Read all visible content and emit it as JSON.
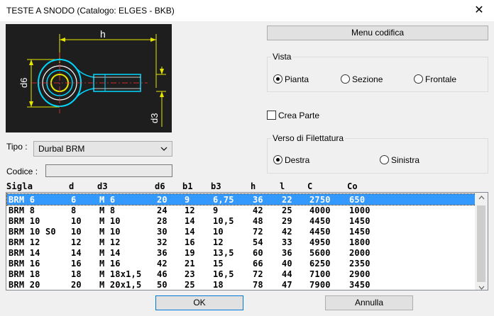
{
  "window": {
    "title": "TESTE A SNODO (Catalogo: ELGES - BKB)",
    "close_glyph": "✕"
  },
  "drawing": {
    "dim_h": "h",
    "dim_d6": "d6",
    "dim_d3": "d3"
  },
  "menu_button": "Menu codifica",
  "vista": {
    "label": "Vista",
    "options": [
      {
        "label": "Pianta",
        "selected": true
      },
      {
        "label": "Sezione",
        "selected": false
      },
      {
        "label": "Frontale",
        "selected": false
      }
    ]
  },
  "crea_parte": {
    "label": "Crea Parte",
    "checked": false
  },
  "verso": {
    "label": "Verso di Filettatura",
    "options": [
      {
        "label": "Destra",
        "selected": true
      },
      {
        "label": "Sinistra",
        "selected": false
      }
    ]
  },
  "tipo": {
    "label": "Tipo :",
    "value": "Durbal BRM"
  },
  "codice": {
    "label": "Codice :",
    "value": ""
  },
  "table": {
    "headers": [
      "Sigla",
      "d",
      "d3",
      "d6",
      "b1",
      "b3",
      "h",
      "l",
      "C",
      "Co"
    ],
    "rows": [
      [
        "BRM 6",
        "6",
        "M 6",
        "20",
        "9",
        "6,75",
        "36",
        "22",
        "2750",
        "650"
      ],
      [
        "BRM 8",
        "8",
        "M 8",
        "24",
        "12",
        "9",
        "42",
        "25",
        "4000",
        "1000"
      ],
      [
        "BRM 10",
        "10",
        "M 10",
        "28",
        "14",
        "10,5",
        "48",
        "29",
        "4450",
        "1450"
      ],
      [
        "BRM 10 S0",
        "10",
        "M 10",
        "30",
        "14",
        "10",
        "72",
        "42",
        "4450",
        "1450"
      ],
      [
        "BRM 12",
        "12",
        "M 12",
        "32",
        "16",
        "12",
        "54",
        "33",
        "4950",
        "1800"
      ],
      [
        "BRM 14",
        "14",
        "M 14",
        "36",
        "19",
        "13,5",
        "60",
        "36",
        "5600",
        "2000"
      ],
      [
        "BRM 16",
        "16",
        "M 16",
        "42",
        "21",
        "15",
        "66",
        "40",
        "6250",
        "2350"
      ],
      [
        "BRM 18",
        "18",
        "M 18x1,5",
        "46",
        "23",
        "16,5",
        "72",
        "44",
        "7100",
        "2900"
      ],
      [
        "BRM 20",
        "20",
        "M 20x1,5",
        "50",
        "25",
        "18",
        "78",
        "47",
        "7900",
        "3450"
      ]
    ],
    "selected_row": 0
  },
  "buttons": {
    "ok": "OK",
    "cancel": "Annulla"
  }
}
